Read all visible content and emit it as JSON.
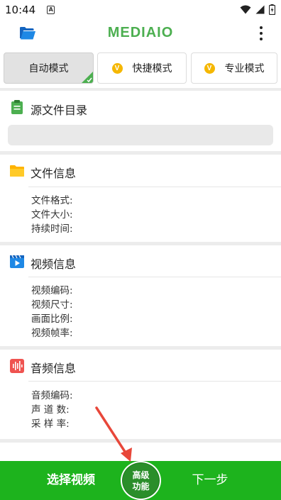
{
  "status_bar": {
    "time": "10:44",
    "notif_letter": "A"
  },
  "app_bar": {
    "title": "MEDIAIO",
    "icons": [
      "folder-open-icon",
      "more-vert-icon"
    ]
  },
  "modes": [
    {
      "label": "自动模式",
      "active": true,
      "badge": ""
    },
    {
      "label": "快捷模式",
      "active": false,
      "badge": "V"
    },
    {
      "label": "专业模式",
      "active": false,
      "badge": "V"
    }
  ],
  "source_dir": {
    "title": "源文件目录",
    "path_value": ""
  },
  "file_info": {
    "title": "文件信息",
    "fields": [
      "文件格式:",
      "文件大小:",
      "持续时间:"
    ]
  },
  "video_info": {
    "title": "视频信息",
    "fields": [
      "视频编码:",
      "视频尺寸:",
      "画面比例:",
      "视频帧率:"
    ]
  },
  "audio_info": {
    "title": "音频信息",
    "fields": [
      "音频编码:",
      "声 道 数:",
      "采 样 率:"
    ]
  },
  "bottom_bar": {
    "select_label": "选择视频",
    "advanced_line1": "高级",
    "advanced_line2": "功能",
    "next_label": "下一步"
  },
  "colors": {
    "accent_green": "#1db31d",
    "title_green": "#4caf50",
    "vip_gold": "#f5b700",
    "annotation_red": "#e8473a"
  }
}
